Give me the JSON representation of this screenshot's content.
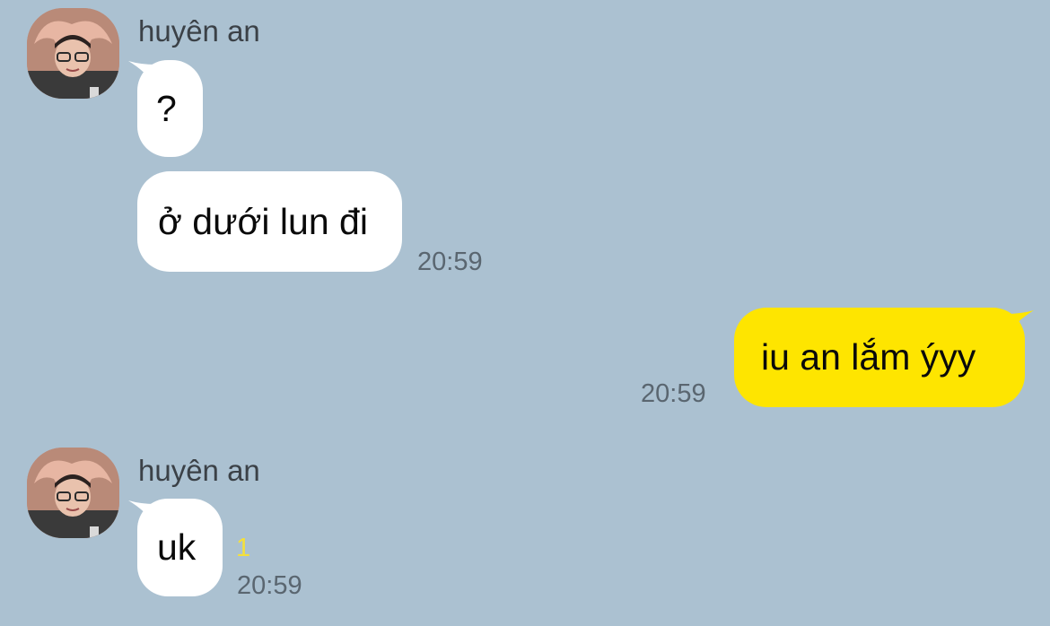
{
  "colors": {
    "background": "#abc1d1",
    "incoming_bubble": "#ffffff",
    "outgoing_bubble": "#fee500",
    "time_text": "#5a6670",
    "unread_count": "#f5e03a"
  },
  "groups": [
    {
      "sender": "huyên an",
      "avatar": "profile-photo",
      "messages": [
        {
          "text": "?"
        },
        {
          "text": "ở dưới lun đi",
          "time": "20:59"
        }
      ]
    },
    {
      "sender": "me",
      "messages": [
        {
          "text": "iu an lắm ýyy",
          "time": "20:59"
        }
      ]
    },
    {
      "sender": "huyên an",
      "avatar": "profile-photo",
      "messages": [
        {
          "text": "uk",
          "unread": "1",
          "time": "20:59"
        }
      ]
    }
  ]
}
